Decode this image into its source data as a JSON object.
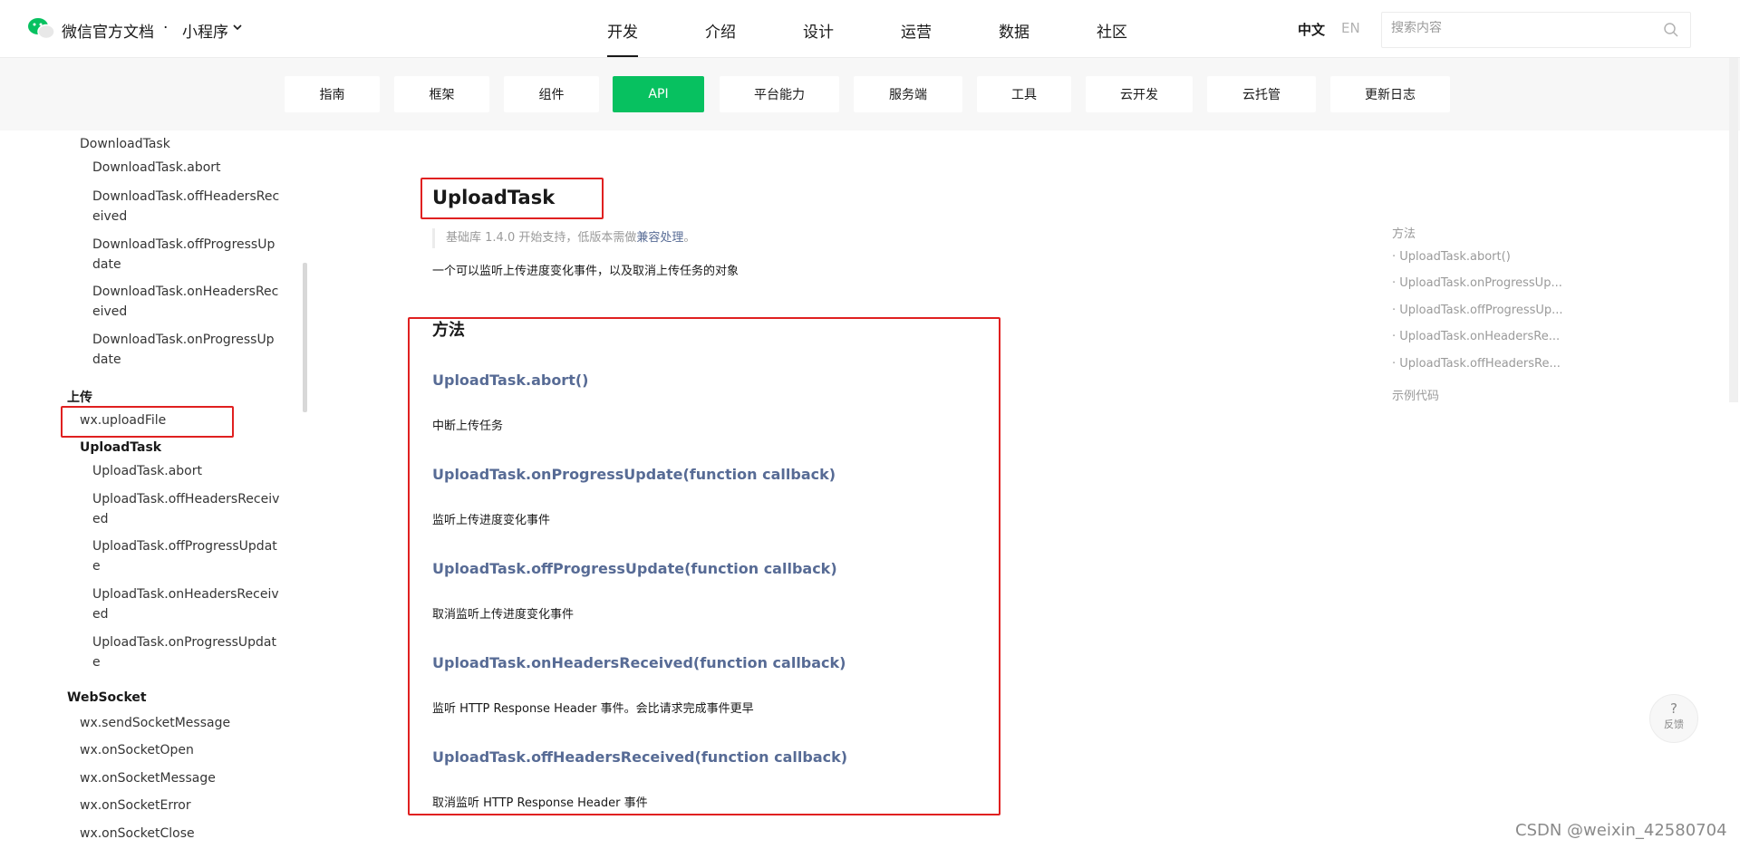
{
  "header": {
    "site_title": "微信官方文档",
    "separator": "·",
    "product": "小程序",
    "nav": [
      "开发",
      "介绍",
      "设计",
      "运营",
      "数据",
      "社区"
    ],
    "lang_zh": "中文",
    "lang_en": "EN",
    "search_placeholder": "搜索内容",
    "colors": {
      "brand_green": "#07c160",
      "link_blue": "#576b95",
      "annotation_red": "#e02020"
    }
  },
  "subnav": {
    "tabs": [
      "指南",
      "框架",
      "组件",
      "API",
      "平台能力",
      "服务端",
      "工具",
      "云开发",
      "云托管",
      "更新日志"
    ],
    "active": "API"
  },
  "sidebar": {
    "download_task": "DownloadTask",
    "download_items": [
      "DownloadTask.abort",
      "DownloadTask.offHeadersRec\neived",
      "DownloadTask.offProgressUp\ndate",
      "DownloadTask.onHeadersRec\neived",
      "DownloadTask.onProgressUp\ndate"
    ],
    "upload_section": "上传",
    "upload_file": "wx.uploadFile",
    "upload_task": "UploadTask",
    "upload_items": [
      "UploadTask.abort",
      "UploadTask.offHeadersReceiv\ned",
      "UploadTask.offProgressUpdat\ne",
      "UploadTask.onHeadersReceiv\ned",
      "UploadTask.onProgressUpdat\ne"
    ],
    "websocket_section": "WebSocket",
    "websocket_items": [
      "wx.sendSocketMessage",
      "wx.onSocketOpen",
      "wx.onSocketMessage",
      "wx.onSocketError",
      "wx.onSocketClose"
    ]
  },
  "main": {
    "title": "UploadTask",
    "note_prefix": "基础库 1.4.0 开始支持，低版本需做",
    "note_link": "兼容处理",
    "note_suffix": "。",
    "description": "一个可以监听上传进度变化事件，以及取消上传任务的对象",
    "methods_heading": "方法",
    "methods": [
      {
        "name": "UploadTask.abort()",
        "desc": "中断上传任务"
      },
      {
        "name": "UploadTask.onProgressUpdate(function callback)",
        "desc": "监听上传进度变化事件"
      },
      {
        "name": "UploadTask.offProgressUpdate(function callback)",
        "desc": "取消监听上传进度变化事件"
      },
      {
        "name": "UploadTask.onHeadersReceived(function callback)",
        "desc": "监听 HTTP Response Header 事件。会比请求完成事件更早"
      },
      {
        "name": "UploadTask.offHeadersReceived(function callback)",
        "desc": "取消监听 HTTP Response Header 事件"
      }
    ]
  },
  "toc": {
    "label": "方法",
    "items": [
      "· UploadTask.abort()",
      "· UploadTask.onProgressUp...",
      "· UploadTask.offProgressUp...",
      "· UploadTask.onHeadersRe...",
      "· UploadTask.offHeadersRe..."
    ],
    "example": "示例代码"
  },
  "feedback": {
    "icon": "?",
    "label": "反馈"
  },
  "watermark": "CSDN @weixin_42580704"
}
